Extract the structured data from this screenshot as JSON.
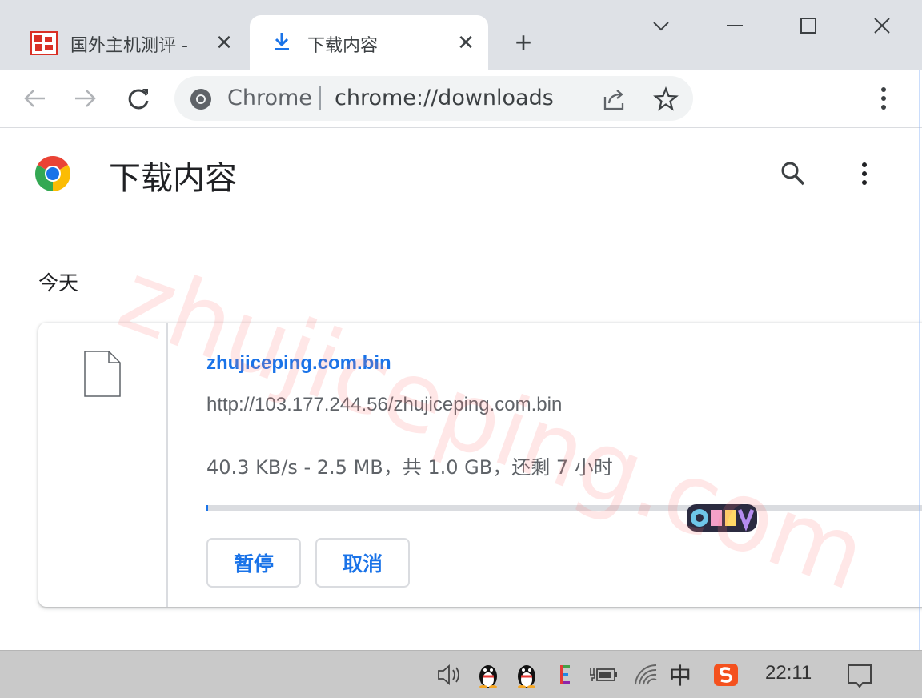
{
  "tabs": [
    {
      "title": "国外主机测评 - ",
      "active": false,
      "icon": "site-favicon"
    },
    {
      "title": "下载内容",
      "active": true,
      "icon": "download-icon"
    }
  ],
  "toolbar": {
    "site_label": "Chrome",
    "url": "chrome://downloads",
    "accent": "#1a73e8"
  },
  "page": {
    "title": "下载内容",
    "section": "今天"
  },
  "download": {
    "file_name": "zhujiceping.com.bin",
    "url": "http://103.177.244.56/zhujiceping.com.bin",
    "status": "40.3 KB/s - 2.5 MB，共 1.0 GB，还剩 7 小时",
    "progress": 0.0025,
    "pause_label": "暂停",
    "cancel_label": "取消"
  },
  "watermark": "zhujiceping.com",
  "taskbar": {
    "ime": "中",
    "clock": "22:11"
  }
}
